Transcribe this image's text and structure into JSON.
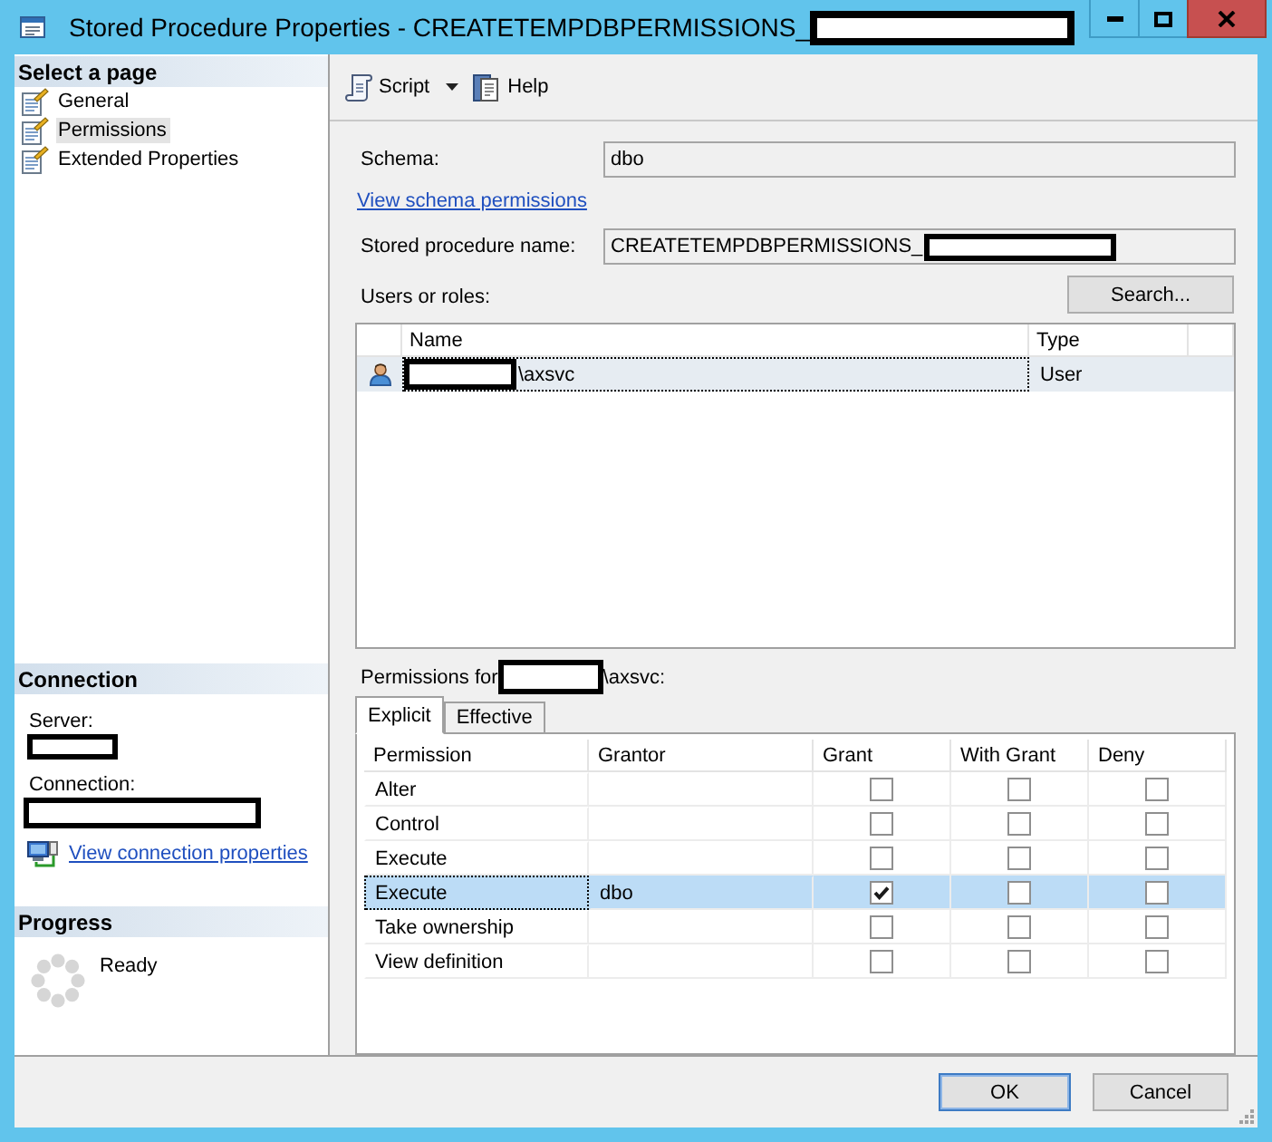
{
  "window": {
    "title": "Stored Procedure Properties - CREATETEMPDBPERMISSIONS_",
    "title_redacted": true
  },
  "sidebar": {
    "heading": "Select a page",
    "items": [
      {
        "label": "General",
        "selected": false
      },
      {
        "label": "Permissions",
        "selected": true
      },
      {
        "label": "Extended Properties",
        "selected": false
      }
    ]
  },
  "connection": {
    "heading": "Connection",
    "server_label": "Server:",
    "server_redacted": true,
    "connection_label": "Connection:",
    "connection_redacted": true,
    "link": "View connection properties"
  },
  "progress": {
    "heading": "Progress",
    "status": "Ready"
  },
  "toolbar": [
    {
      "label": "Script",
      "kind": "dropdown"
    },
    {
      "label": "Help",
      "kind": "help"
    }
  ],
  "form": {
    "schema_label": "Schema:",
    "schema_value": "dbo",
    "schema_link": "View schema permissions",
    "name_label": "Stored procedure name:",
    "name_value": "CREATETEMPDBPERMISSIONS_",
    "name_redacted": true,
    "users_label": "Users or roles:",
    "search_button": "Search..."
  },
  "users_table": {
    "columns": [
      "Name",
      "Type"
    ],
    "rows": [
      {
        "name": "\\axsvc",
        "name_redacted": true,
        "type": "User",
        "selected": true
      }
    ]
  },
  "permissions": {
    "label": "Permissions for",
    "label_redacted": true,
    "label_suffix": "\\axsvc:",
    "tabs": [
      {
        "label": "Explicit",
        "selected": true
      },
      {
        "label": "Effective",
        "selected": false
      }
    ],
    "columns": [
      "Permission",
      "Grantor",
      "Grant",
      "With Grant",
      "Deny"
    ],
    "rows": [
      {
        "permission": "Alter",
        "grant": false,
        "with_grant": false,
        "deny": false,
        "selected": false
      },
      {
        "permission": "Control",
        "grant": false,
        "with_grant": false,
        "deny": false,
        "selected": false
      },
      {
        "permission": "Execute",
        "grant": false,
        "with_grant": false,
        "deny": false,
        "selected": false
      },
      {
        "permission": "Execute",
        "grantor": "dbo",
        "grant": true,
        "with_grant": false,
        "deny": false,
        "selected": true
      },
      {
        "permission": "Take ownership",
        "grant": false,
        "with_grant": false,
        "deny": false,
        "selected": false
      },
      {
        "permission": "View definition",
        "grant": false,
        "with_grant": false,
        "deny": false,
        "selected": false
      }
    ]
  },
  "buttons": [
    {
      "label": "OK",
      "default": true
    },
    {
      "label": "Cancel",
      "default": false
    }
  ]
}
